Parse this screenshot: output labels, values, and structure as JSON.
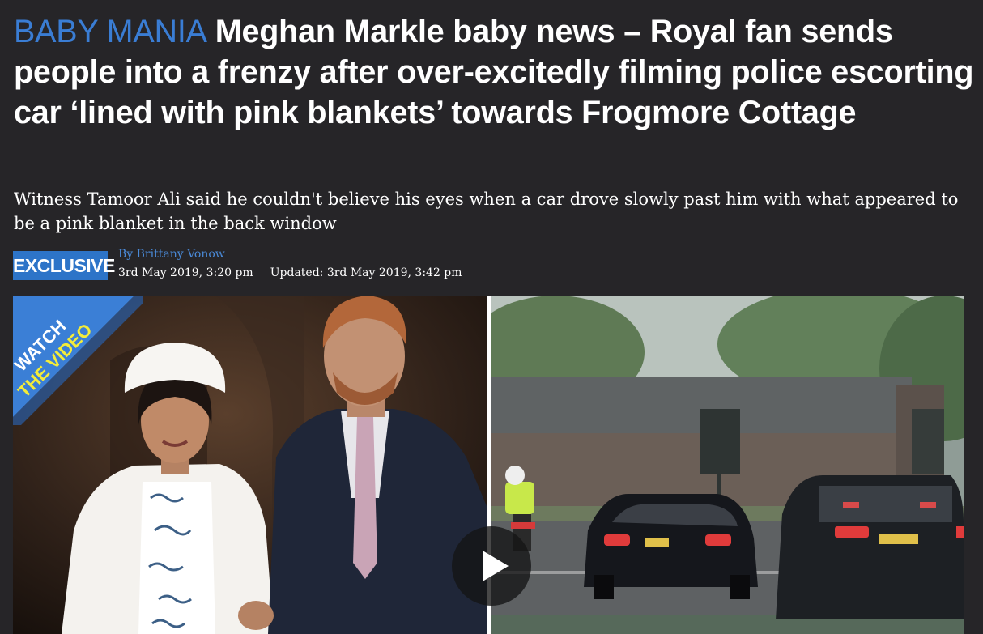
{
  "article": {
    "kicker": "BABY MANIA",
    "headline": "Meghan Markle baby news – Royal fan sends people into a frenzy after over-excitedly filming police escorting car ‘lined with pink blankets’ towards Frogmore Cottage",
    "standfirst": "Witness Tamoor Ali said he couldn't believe his eyes when a car drove slowly past him with what appeared to be a pink blanket in the back window",
    "badge": "EXCLUSIVE",
    "byline": "By Brittany Vonow",
    "published": "3rd May 2019, 3:20 pm",
    "updated": "Updated: 3rd May 2019, 3:42 pm"
  },
  "media": {
    "watch_banner_line1": "WATCH",
    "watch_banner_line2": "THE VIDEO",
    "play_icon": "play-icon"
  },
  "colors": {
    "background": "#262528",
    "kicker": "#3a7dd4",
    "badge": "#2d74c8",
    "banner_blue": "#3b7fd6",
    "banner_yellow": "#f3ec3a"
  }
}
